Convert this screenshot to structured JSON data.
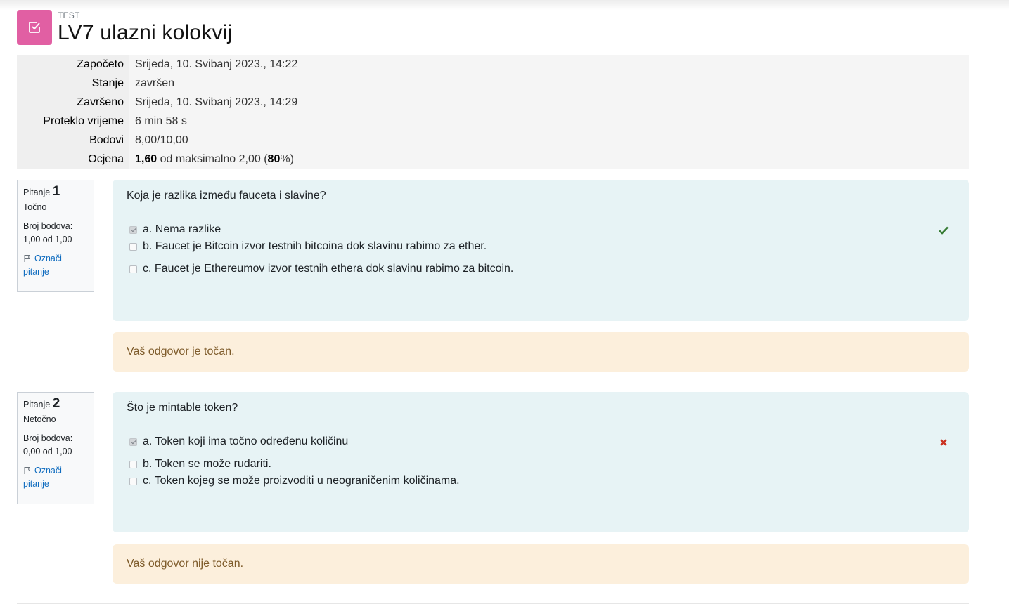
{
  "header": {
    "pretitle": "TEST",
    "title": "LV7 ulazni kolokvij",
    "icon": "quiz-checkbox-icon",
    "icon_color": "#e15fa3"
  },
  "summary": {
    "started_label": "Započeto",
    "started_value": "Srijeda, 10. Svibanj 2023., 14:22",
    "state_label": "Stanje",
    "state_value": "završen",
    "completed_label": "Završeno",
    "completed_value": "Srijeda, 10. Svibanj 2023., 14:29",
    "time_label": "Proteklo vrijeme",
    "time_value": "6 min 58 s",
    "marks_label": "Bodovi",
    "marks_value": "8,00/10,00",
    "grade_label": "Ocjena",
    "grade_value": "1,60",
    "grade_mid": " od maksimalno 2,00 (",
    "grade_percent": "80",
    "grade_end": "%)"
  },
  "questions": [
    {
      "label": "Pitanje",
      "number": "1",
      "state": "Točno",
      "grade_label": "Broj bodova:",
      "grade_value": "1,00 od 1,00",
      "flag_label_1": "Označi",
      "flag_label_2": "pitanje",
      "text": "Koja je razlika između fauceta i slavine?",
      "answers": [
        {
          "text": "a. Nema razlike",
          "checked": true
        },
        {
          "text": "b. Faucet je Bitcoin izvor testnih bitcoina dok slavinu rabimo za ether.",
          "checked": false
        },
        {
          "text": "c. Faucet je Ethereumov izvor testnih ethera dok slavinu rabimo za bitcoin.",
          "checked": false
        }
      ],
      "mark": "correct-check-icon",
      "mark_color": "#357a32",
      "feedback": "Vaš odgovor je točan."
    },
    {
      "label": "Pitanje",
      "number": "2",
      "state": "Netočno",
      "grade_label": "Broj bodova:",
      "grade_value": "0,00 od 1,00",
      "flag_label_1": "Označi",
      "flag_label_2": "pitanje",
      "text": "Što je mintable token?",
      "answers": [
        {
          "text": "a. Token koji ima točno određenu količinu",
          "checked": true
        },
        {
          "text": "b. Token se može rudariti.",
          "checked": false
        },
        {
          "text": "c. Token kojeg se može proizvoditi u neograničenim količinama.",
          "checked": false
        }
      ],
      "mark": "incorrect-cross-icon",
      "mark_color": "#ca3120",
      "feedback": "Vaš odgovor nije točan."
    }
  ]
}
